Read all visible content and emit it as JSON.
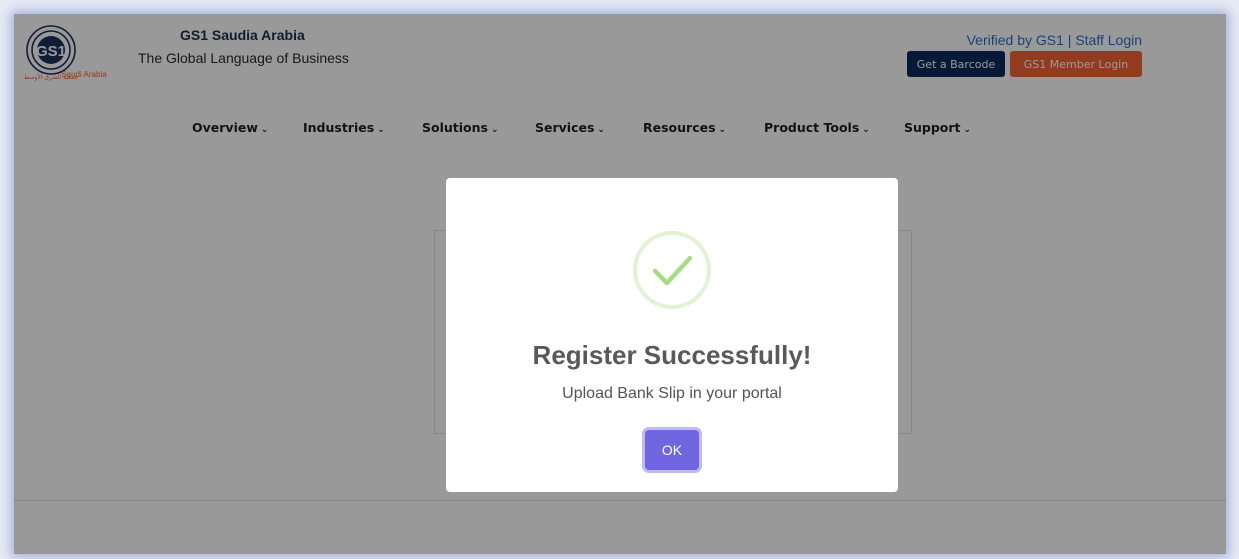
{
  "header": {
    "brand_title": "GS1 Saudia Arabia",
    "brand_subtitle": "The Global Language of Business",
    "logo": {
      "mark": "GS1",
      "caption": "Saudi Arabia",
      "arabic_caption": "جمعية الشرق الأوسط"
    },
    "verified_link": "Verified by GS1",
    "separator": "|",
    "staff_login_link": "Staff Login",
    "get_barcode_button": "Get a Barcode",
    "member_login_button": "GS1 Member Login"
  },
  "nav": {
    "items": [
      {
        "label": "Overview"
      },
      {
        "label": "Industries"
      },
      {
        "label": "Solutions"
      },
      {
        "label": "Services"
      },
      {
        "label": "Resources"
      },
      {
        "label": "Product Tools"
      },
      {
        "label": "Support"
      }
    ],
    "chevron": "⌄"
  },
  "modal": {
    "title": "Register Successfully!",
    "text": "Upload Bank Slip in your portal",
    "ok_button": "OK",
    "icon": "success-check-icon"
  },
  "colors": {
    "brand_navy": "#0b2b5c",
    "brand_orange": "#f26334",
    "link_blue": "#2d6fc7",
    "confirm_purple": "#7066e0",
    "success_green": "#a5dc86"
  }
}
